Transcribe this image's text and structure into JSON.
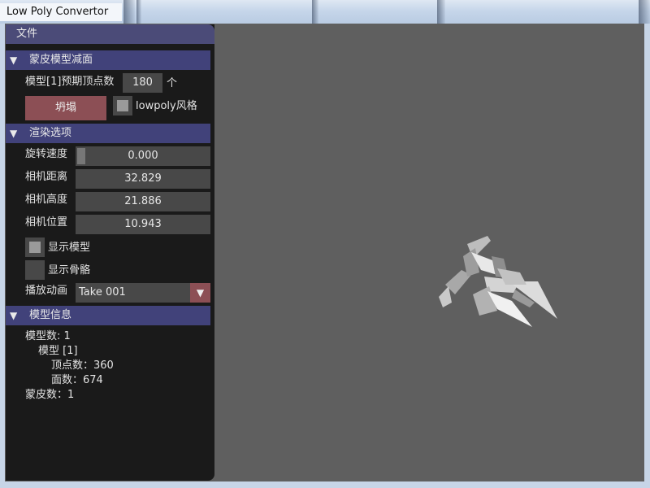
{
  "window": {
    "title": "Low Poly Convertor"
  },
  "menu": {
    "file": "文件"
  },
  "sections": {
    "decimate": {
      "title": "蒙皮模型减面"
    },
    "render": {
      "title": "渲染选项"
    },
    "info": {
      "title": "模型信息"
    }
  },
  "decimate": {
    "expected_label": "模型[1]预期顶点数",
    "expected_value": "180",
    "unit": "个",
    "collapse_button": "坍塌",
    "lowpoly_label": "lowpoly风格",
    "lowpoly_checked": true
  },
  "render": {
    "rotation_label": "旋转速度",
    "rotation_value": "0.000",
    "cam_distance_label": "相机距离",
    "cam_distance_value": "32.829",
    "cam_height_label": "相机高度",
    "cam_height_value": "21.886",
    "cam_position_label": "相机位置",
    "cam_position_value": "10.943",
    "show_model_label": "显示模型",
    "show_model_checked": true,
    "show_skeleton_label": "显示骨骼",
    "show_skeleton_checked": false,
    "animation_label": "播放动画",
    "animation_value": "Take 001"
  },
  "info": {
    "model_count": "模型数: 1",
    "model_item": "模型 [1]",
    "vertex_count": "顶点数：360",
    "face_count": "面数：674",
    "skin_count": "蒙皮数：1"
  },
  "colors": {
    "panel_bg": "#1a1a1a",
    "section_header": "#41427a",
    "menubar": "#4b4b78",
    "button": "#8c4f55",
    "viewport_bg": "#5f5f5f"
  }
}
